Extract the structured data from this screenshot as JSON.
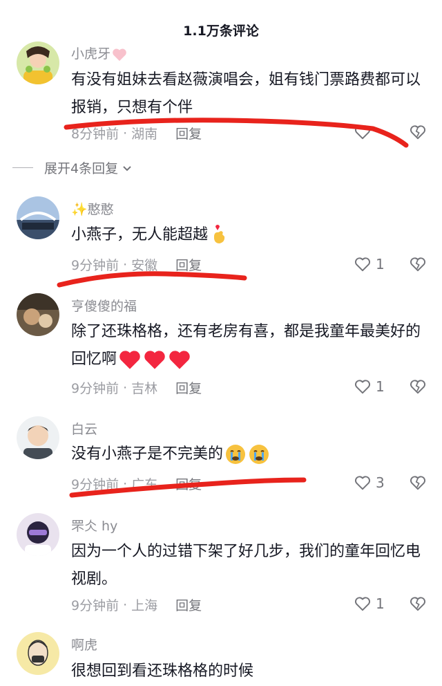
{
  "header": {
    "title": "1.1万条评论"
  },
  "comments": [
    {
      "username": "小虎牙",
      "text": "有没有姐妹去看赵薇演唱会，姐有钱门票路费都可以报销，只想有个伴",
      "time": "8分钟前",
      "location": "湖南",
      "reply": "回复",
      "likes": "",
      "expand": "展开4条回复"
    },
    {
      "username": "✨憨憨",
      "text": "小燕子，无人能超越",
      "time": "9分钟前",
      "location": "安徽",
      "reply": "回复",
      "likes": "1"
    },
    {
      "username": "亨傻傻的福",
      "text": "除了还珠格格，还有老房有喜，都是我童年最美好的回忆啊",
      "time": "9分钟前",
      "location": "吉林",
      "reply": "回复",
      "likes": "1"
    },
    {
      "username": "白云",
      "text": "没有小燕子是不完美的",
      "time": "9分钟前",
      "location": "广东",
      "reply": "回复",
      "likes": "3"
    },
    {
      "username": "罘仌 hy",
      "text": "因为一个人的过错下架了好几步，我们的童年回忆电视剧。",
      "time": "9分钟前",
      "location": "上海",
      "reply": "回复",
      "likes": "1"
    },
    {
      "username": "啊虎",
      "text": "很想回到看还珠格格的时候"
    }
  ],
  "separator": "·",
  "colors": {
    "annotation_red": "#e8231c",
    "heart": "#f3263f",
    "text": "#161823",
    "muted": "#8a8b91"
  }
}
